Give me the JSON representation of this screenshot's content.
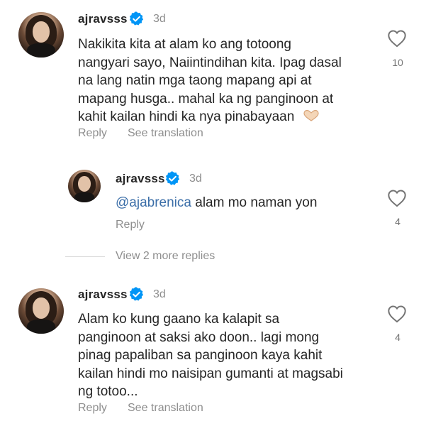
{
  "comments": [
    {
      "username": "ajravsss",
      "time": "3d",
      "lines": [
        "Nakikita kita at alam ko ang totoong",
        "nangyari sayo, Naiintindihan kita. Ipag dasal",
        "na lang natin mga taong mapang api at",
        "mapang husga.. mahal ka ng panginoon at",
        "kahit kailan hindi ka nya pinabayaan"
      ],
      "emoji": "heart-hands-icon",
      "reply_label": "Reply",
      "translate_label": "See translation",
      "likes": "10"
    },
    {
      "username": "ajravsss",
      "time": "3d",
      "mention": "@ajabrenica",
      "text": " alam mo naman yon",
      "reply_label": "Reply",
      "likes": "4"
    },
    {
      "username": "ajravsss",
      "time": "3d",
      "lines": [
        "Alam ko kung gaano ka kalapit sa",
        "panginoon at saksi ako doon.. lagi mong",
        "pinag papaliban sa panginoon kaya kahit",
        "kailan hindi mo naisipan gumanti at magsabi",
        "ng totoo..."
      ],
      "reply_label": "Reply",
      "translate_label": "See translation",
      "likes": "4"
    }
  ],
  "view_more_label": "View 2 more replies",
  "colors": {
    "text": "#262626",
    "secondary": "#8e8e8e",
    "verified": "#0095f6",
    "mention": "#3b6ea8"
  }
}
